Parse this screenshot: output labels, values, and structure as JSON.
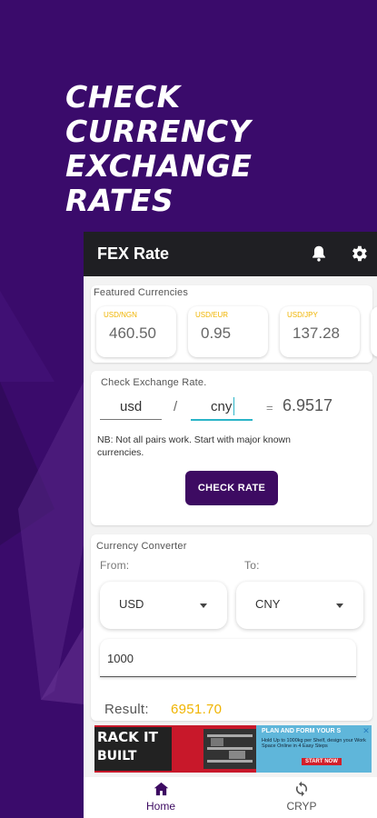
{
  "promo": {
    "headline": [
      "CHECK",
      "CURRENCY",
      "EXCHANGE",
      "RATES"
    ]
  },
  "app": {
    "title": "FEX Rate",
    "icons": {
      "notifications": "bell-icon",
      "settings": "gear-icon"
    }
  },
  "featured": {
    "label": "Featured Currencies",
    "cards": [
      {
        "pair": "USD/NGN",
        "value": "460.50"
      },
      {
        "pair": "USD/EUR",
        "value": "0.95"
      },
      {
        "pair": "USD/JPY",
        "value": "137.28"
      }
    ]
  },
  "exchange": {
    "label": "Check Exchange Rate.",
    "from": "usd",
    "separator": "/",
    "to": "cny",
    "equals": "=",
    "result": "6.9517",
    "note": "NB: Not all pairs work. Start with major known currencies.",
    "button": "CHECK RATE"
  },
  "converter": {
    "label": "Currency Converter",
    "from_label": "From:",
    "to_label": "To:",
    "from_value": "USD",
    "to_value": "CNY",
    "amount": "1000",
    "result_label": "Result:",
    "result_value": "6951.70"
  },
  "ad": {
    "left_brand": "RACK IT",
    "left_sub": "BUILT",
    "right_headline": "PLAN AND FORM YOUR S",
    "right_body": "Hold Up to 1000kg per Shelf, design your Work Space Online in 4 Easy Steps",
    "cta": "START NOW"
  },
  "nav": {
    "items": [
      {
        "label": "Home",
        "icon": "home-icon"
      },
      {
        "label": "CRYP",
        "icon": "sync-icon"
      }
    ]
  },
  "colors": {
    "background": "#3a0b6b",
    "accent": "#3d0b62",
    "highlight": "#f0b400",
    "topbar": "#1f1f23"
  }
}
